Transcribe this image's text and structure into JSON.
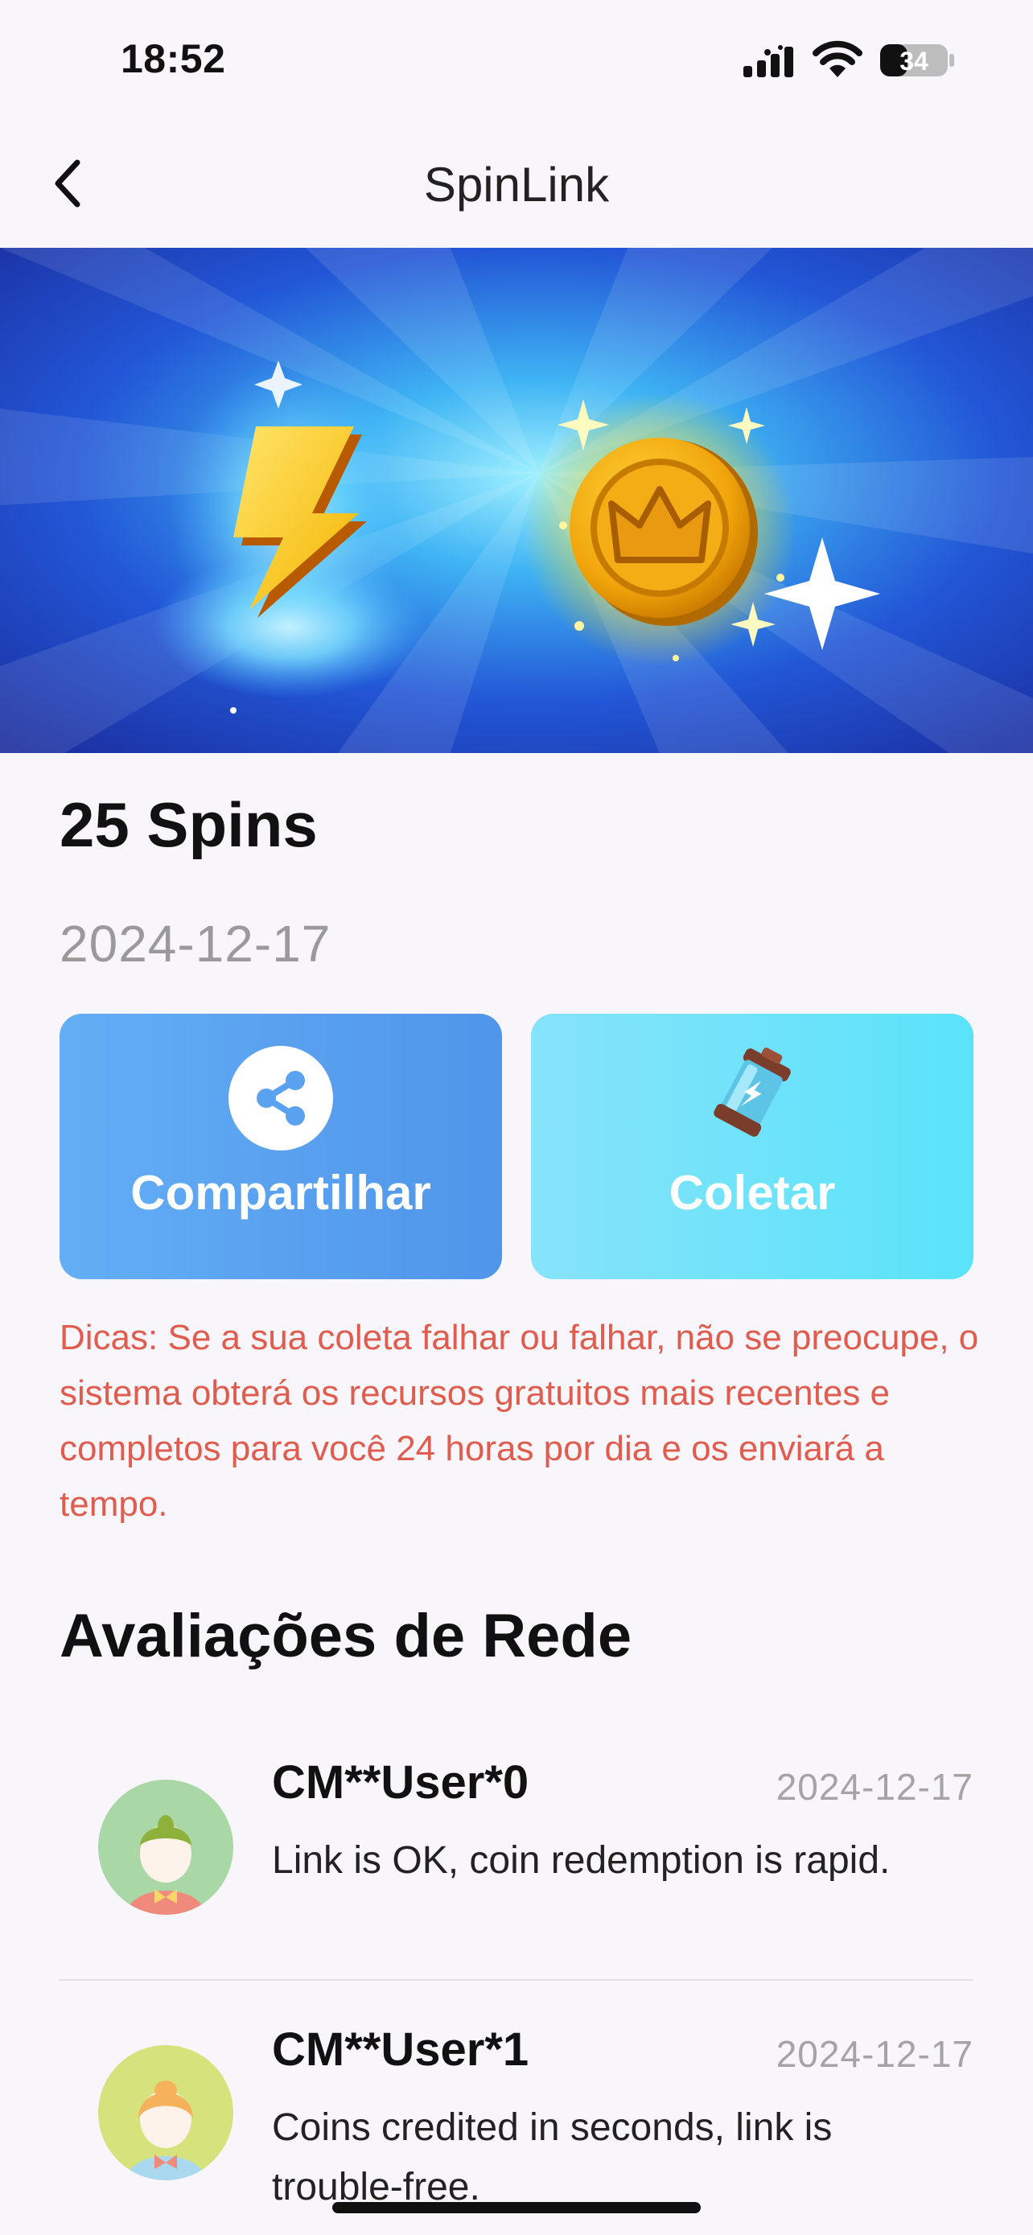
{
  "status_bar": {
    "time": "18:52",
    "battery": "34"
  },
  "nav": {
    "title": "SpinLink"
  },
  "item": {
    "title": "25 Spins",
    "date": "2024-12-17"
  },
  "actions": {
    "share_label": "Compartilhar",
    "collect_label": "Coletar"
  },
  "tips": "Dicas: Se a sua coleta falhar ou falhar, não se preocupe, o sistema obterá os recursos gratuitos mais recentes e completos para você 24 horas por dia e os enviará a tempo.",
  "reviews": {
    "title": "Avaliações de Rede",
    "items": [
      {
        "user": "CM**User*0",
        "date": "2024-12-17",
        "text": "Link is OK, coin redemption is rapid."
      },
      {
        "user": "CM**User*1",
        "date": "2024-12-17",
        "text": "Coins credited in seconds, link is trouble-free."
      }
    ]
  },
  "colors": {
    "share_button": "#5aa2f0",
    "collect_button": "#6fe3fa",
    "tips_text": "#e05c4e",
    "banner_blue": "#1d4fd0"
  },
  "icons": [
    "back-chevron-icon",
    "signal-icon",
    "wifi-icon",
    "battery-icon",
    "share-icon",
    "battery-pack-icon",
    "lightning-icon",
    "crown-coin-icon",
    "avatar-icon"
  ]
}
